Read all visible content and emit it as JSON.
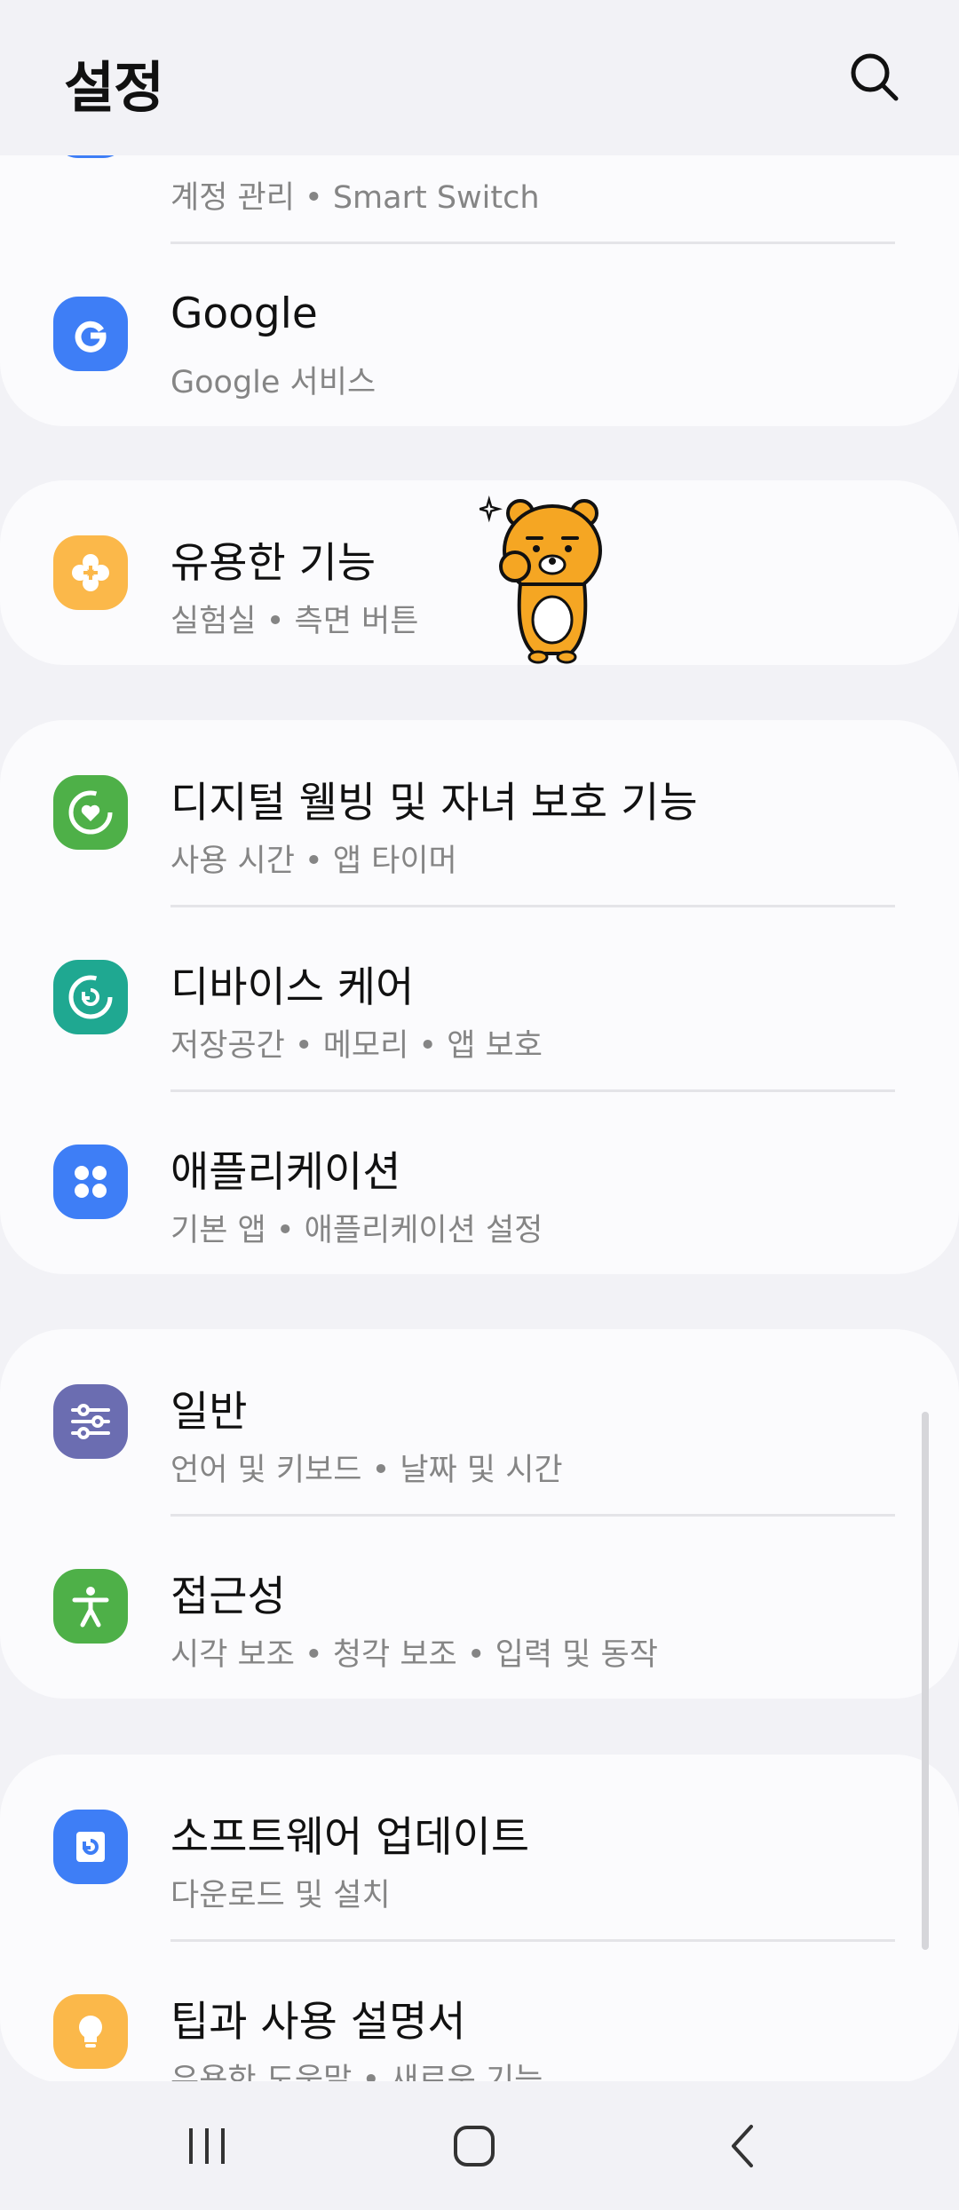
{
  "header": {
    "title": "설정"
  },
  "cards": [
    {
      "items": [
        {
          "title": "",
          "subtitle": "계정 관리  •  Smart Switch",
          "icon": "account-icon",
          "color": "#3e7ef6"
        },
        {
          "title": "Google",
          "subtitle": "Google 서비스",
          "icon": "google-icon",
          "color": "#3e7ef6"
        }
      ]
    },
    {
      "items": [
        {
          "title": "유용한 기능",
          "subtitle": "실험실  •  측면 버튼",
          "icon": "puzzle-icon",
          "color": "#fbb84a"
        }
      ]
    },
    {
      "items": [
        {
          "title": "디지털 웰빙 및 자녀 보호 기능",
          "subtitle": "사용 시간  •  앱 타이머",
          "icon": "wellbeing-icon",
          "color": "#4eb048"
        },
        {
          "title": "디바이스 케어",
          "subtitle": "저장공간  •  메모리  •  앱 보호",
          "icon": "device-care-icon",
          "color": "#1fa891"
        },
        {
          "title": "애플리케이션",
          "subtitle": "기본 앱  •  애플리케이션 설정",
          "icon": "apps-icon",
          "color": "#3e7ef6"
        }
      ]
    },
    {
      "items": [
        {
          "title": "일반",
          "subtitle": "언어 및 키보드  •  날짜 및 시간",
          "icon": "general-sliders-icon",
          "color": "#6b6db1"
        },
        {
          "title": "접근성",
          "subtitle": "시각 보조  •  청각 보조  •  입력 및 동작",
          "icon": "accessibility-icon",
          "color": "#4eb048"
        }
      ]
    },
    {
      "items": [
        {
          "title": "소프트웨어 업데이트",
          "subtitle": "다운로드 및 설치",
          "icon": "software-update-icon",
          "color": "#3e7ef6"
        },
        {
          "title": "팁과 사용 설명서",
          "subtitle": "유용한 도움말  •  새로운 기능",
          "icon": "lightbulb-icon",
          "color": "#fbb84a"
        }
      ]
    }
  ],
  "navbar": {
    "recent": "recent-apps-icon",
    "home": "home-icon",
    "back": "back-icon"
  }
}
